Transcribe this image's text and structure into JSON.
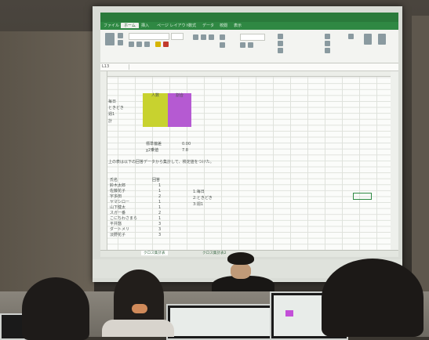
{
  "scene": {
    "kind": "classroom-projection",
    "colors": {
      "ribbon_green": "#2a7a3b",
      "highlight_yellow": "#c8d22f",
      "highlight_purple": "#b55ad2"
    }
  },
  "excel": {
    "window_title": "",
    "ribbon_tabs": [
      "ファイル",
      "ホーム",
      "挿入",
      "ページ レイアウト",
      "数式",
      "データ",
      "校閲",
      "表示"
    ],
    "name_box": "L13",
    "summary": {
      "headers": [
        "人数",
        "割合"
      ],
      "rows": [
        "毎日",
        "ときどき",
        "週1",
        "計"
      ]
    },
    "stats_labels": [
      "標準偏差",
      "χ2乗値"
    ],
    "stats_values": [
      "0.00",
      "7.8"
    ],
    "question_text": "上の表は以下の回答データから集計して、検定値をつけた。",
    "list": {
      "headers": [
        "氏名",
        "回答"
      ],
      "names": [
        "鈴木太郎",
        "佐藤花子",
        "宇多田",
        "ヤマシロー",
        "山下健太",
        "スガー番",
        "こにちわさまら",
        "平井悠",
        "ダートメリ",
        "淡野花子"
      ],
      "answers": [
        "1",
        "1",
        "2",
        "1",
        "1",
        "2",
        "1",
        "3",
        "3",
        "3"
      ]
    },
    "legend_notes": [
      "1:毎日",
      "2:ときどき",
      "3:週1"
    ],
    "sheet_tabs": [
      "クロス集計表",
      "クロス集計表2"
    ]
  }
}
